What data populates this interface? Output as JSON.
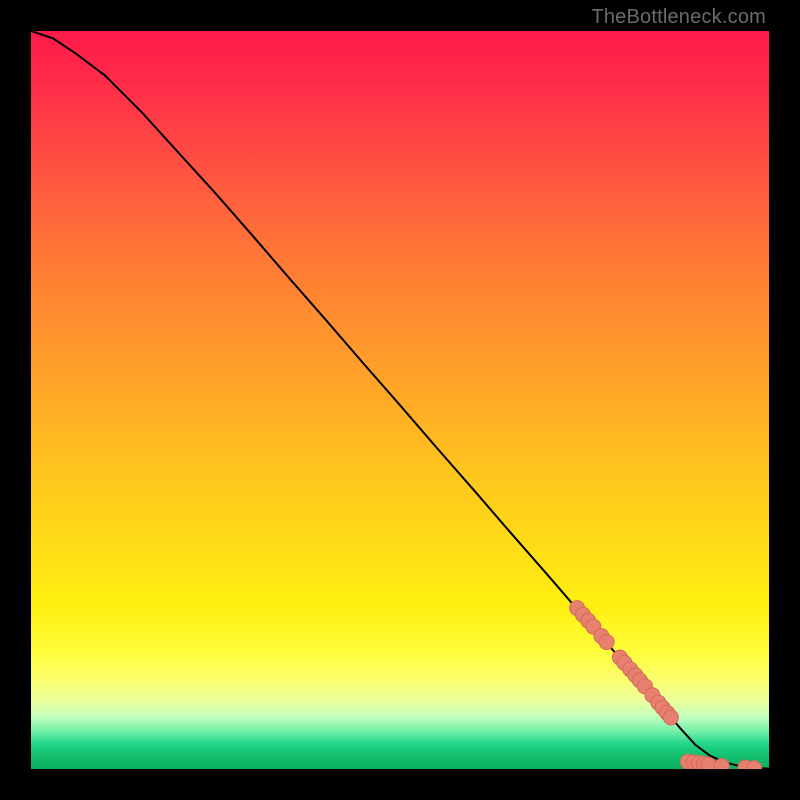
{
  "watermark": "TheBottleneck.com",
  "colors": {
    "marker_fill": "#e8806f",
    "marker_stroke": "#d46a5a",
    "curve": "#000000"
  },
  "chart_data": {
    "type": "line",
    "title": "",
    "xlabel": "",
    "ylabel": "",
    "xlim": [
      0,
      100
    ],
    "ylim": [
      0,
      100
    ],
    "curve": {
      "x": [
        0,
        3,
        6,
        10,
        15,
        20,
        25,
        30,
        35,
        40,
        45,
        50,
        55,
        60,
        65,
        70,
        75,
        80,
        85,
        88,
        90,
        92,
        94,
        96,
        98,
        100
      ],
      "y": [
        100,
        99,
        97,
        94,
        89,
        83.5,
        78,
        72.3,
        66.5,
        60.8,
        55,
        49.3,
        43.5,
        37.8,
        32,
        26.3,
        20.5,
        14.8,
        9,
        5.5,
        3.3,
        1.8,
        0.9,
        0.4,
        0.15,
        0.05
      ]
    },
    "markers": [
      {
        "x": 74.0,
        "y": 21.8
      },
      {
        "x": 74.8,
        "y": 20.9
      },
      {
        "x": 75.5,
        "y": 20.1
      },
      {
        "x": 76.2,
        "y": 19.3
      },
      {
        "x": 77.3,
        "y": 18.0
      },
      {
        "x": 78.0,
        "y": 17.2
      },
      {
        "x": 79.8,
        "y": 15.1
      },
      {
        "x": 80.4,
        "y": 14.4
      },
      {
        "x": 81.2,
        "y": 13.5
      },
      {
        "x": 81.9,
        "y": 12.7
      },
      {
        "x": 82.5,
        "y": 12.0
      },
      {
        "x": 83.2,
        "y": 11.2
      },
      {
        "x": 84.2,
        "y": 10.0
      },
      {
        "x": 85.0,
        "y": 9.0
      },
      {
        "x": 85.6,
        "y": 8.3
      },
      {
        "x": 86.2,
        "y": 7.6
      },
      {
        "x": 86.7,
        "y": 7.0
      },
      {
        "x": 89.0,
        "y": 1.0
      },
      {
        "x": 89.8,
        "y": 0.9
      },
      {
        "x": 90.5,
        "y": 0.8
      },
      {
        "x": 91.2,
        "y": 0.7
      },
      {
        "x": 91.8,
        "y": 0.6
      },
      {
        "x": 93.6,
        "y": 0.4
      },
      {
        "x": 96.8,
        "y": 0.2
      },
      {
        "x": 98.0,
        "y": 0.1
      }
    ]
  }
}
